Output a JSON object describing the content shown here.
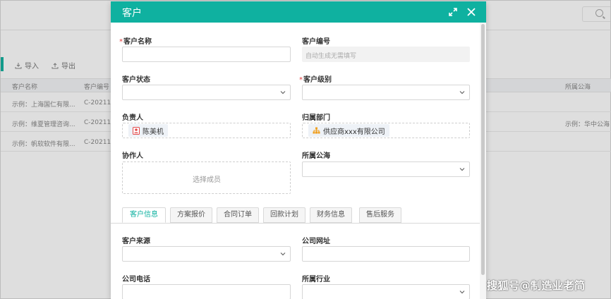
{
  "background": {
    "toolbar": {
      "import_label": "导入",
      "export_label": "导出"
    },
    "table": {
      "headers": [
        "客户名称",
        "客户编号",
        "所属公海"
      ],
      "rows": [
        {
          "name": "示例：上海国仁有限...",
          "code": "C-20211",
          "pool": ""
        },
        {
          "name": "示例：维夏管理咨询...",
          "code": "C-20211",
          "pool": "示例：华中公海"
        },
        {
          "name": "示例：帆软软件有限...",
          "code": "C-20211",
          "pool": ""
        }
      ]
    }
  },
  "modal": {
    "title": "客户",
    "fields": {
      "customer_name": {
        "label": "客户名称",
        "required": "*",
        "value": ""
      },
      "customer_code": {
        "label": "客户编号",
        "placeholder": "自动生成无需填写"
      },
      "customer_status": {
        "label": "客户状态",
        "value": ""
      },
      "customer_level": {
        "label": "客户级别",
        "required": "*",
        "value": ""
      },
      "owner": {
        "label": "负责人",
        "value": "陈美机"
      },
      "department": {
        "label": "归属部门",
        "value": "供应商xxx有限公司"
      },
      "collaborator": {
        "label": "协作人",
        "placeholder": "选择成员"
      },
      "pool": {
        "label": "所属公海",
        "value": ""
      },
      "source": {
        "label": "客户来源",
        "value": ""
      },
      "website": {
        "label": "公司网址",
        "value": ""
      },
      "phone": {
        "label": "公司电话",
        "value": ""
      },
      "industry": {
        "label": "所属行业",
        "value": ""
      }
    },
    "tabs": [
      "客户信息",
      "方案报价",
      "合同订单",
      "回款计划",
      "财务信息",
      "售后服务"
    ],
    "active_tab": 0
  },
  "watermark": "搜狐号@制造业老简",
  "colors": {
    "accent": "#0fb1a0",
    "required": "#e23c3c"
  }
}
